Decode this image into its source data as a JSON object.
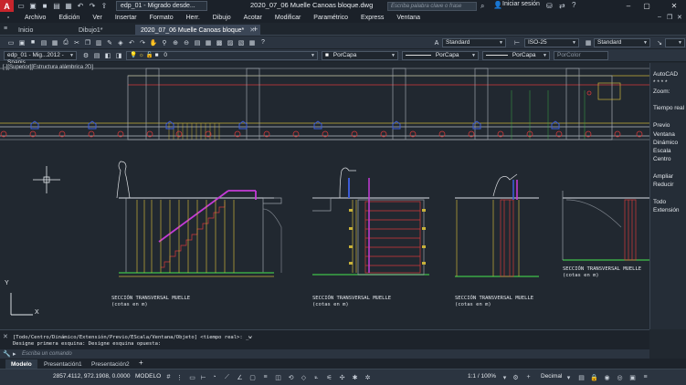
{
  "titlebar": {
    "logo": "A",
    "document_combo": "edp_01 - Migrado desde...",
    "window_title": "2020_07_06 Muelle Canoas bloque.dwg",
    "search_placeholder": "Escriba palabra clave o frase",
    "signin": "Iniciar sesión",
    "minimize_icon": "–",
    "maximize_icon": "▢",
    "close_icon": "✕"
  },
  "menubar": {
    "items": [
      "Archivo",
      "Edición",
      "Ver",
      "Insertar",
      "Formato",
      "Herr.",
      "Dibujo",
      "Acotar",
      "Modificar",
      "Paramétrico",
      "Express",
      "Ventana"
    ]
  },
  "tabs": {
    "items": [
      {
        "label": "Inicio",
        "active": false
      },
      {
        "label": "Dibujo1*",
        "active": false
      },
      {
        "label": "2020_07_06 Muelle Canoas bloque*",
        "active": true
      }
    ],
    "add_icon": "+"
  },
  "toolbar1": {
    "text_style": "Standard",
    "dim_style": "ISO-25",
    "table_style": "Standard"
  },
  "toolbar2": {
    "workspace": "edp_01 - Mig...2012 - Spanis",
    "layer": "0",
    "color": "PorCapa",
    "linetype": "PorCapa",
    "lineweight": "PorCapa",
    "plotstyle": "PorColor"
  },
  "canvas": {
    "viewport_label": "[-][Superior][Estructura alámbrica 2D]",
    "sections": [
      {
        "title": "SECCIÓN TRANSVERSAL MUELLE",
        "subtitle": "(cotas en m)"
      },
      {
        "title": "SECCIÓN TRANSVERSAL MUELLE",
        "subtitle": "(cotas en m)"
      },
      {
        "title": "SECCIÓN TRANSVERSAL MUELLE",
        "subtitle": "(cotas en m)"
      },
      {
        "title": "SECCIÓN TRANSVERSAL MUELLE",
        "subtitle": "(cotas en m)"
      }
    ],
    "ucs_x": "X",
    "ucs_y": "Y"
  },
  "navpanel": {
    "items": [
      "AutoCAD",
      "* * * *",
      "Zoom:",
      "Tiempo real",
      "Previo",
      "Ventana",
      "Dinámico",
      "Escala",
      "Centro",
      "Ampliar",
      "Reducir",
      "Todo",
      "Extensión"
    ]
  },
  "command": {
    "history": [
      "[Todo/Centro/Dinámico/Extensión/Previo/EScala/Ventana/Objeto] <tiempo real>: _w",
      "Designe primera esquina: Designe esquina opuesta:"
    ],
    "placeholder": "Escriba un comando"
  },
  "layout_tabs": {
    "items": [
      {
        "label": "Modelo",
        "active": true
      },
      {
        "label": "Presentación1",
        "active": false
      },
      {
        "label": "Presentación2",
        "active": false
      }
    ],
    "add_icon": "+"
  },
  "statusbar": {
    "coords": "2857.4112, 972.1908, 0.0000",
    "space": "MODELO",
    "scale": "1:1 / 100%",
    "units": "Decimal"
  },
  "colors": {
    "background": "#212830",
    "accent_red": "#c8252c",
    "drawing_yellow": "#c9b23a",
    "drawing_magenta": "#c43ad6",
    "drawing_red": "#d43a3a",
    "drawing_blue": "#3b5bd6",
    "drawing_green": "#3aa845"
  }
}
